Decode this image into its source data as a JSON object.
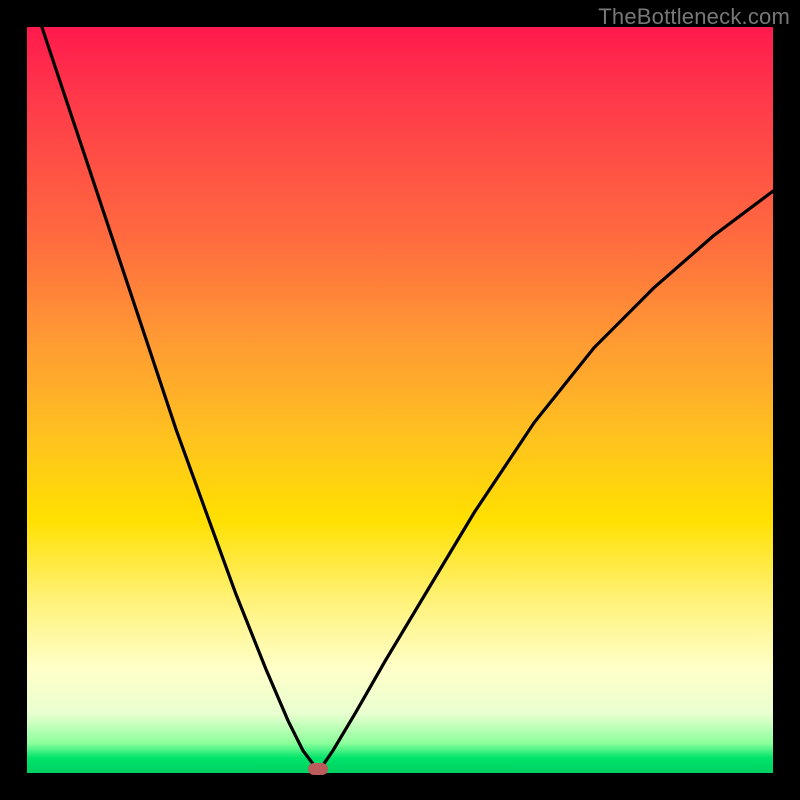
{
  "watermark": "TheBottleneck.com",
  "colors": {
    "frame": "#000000",
    "curve": "#000000",
    "marker": "#bb5b5b",
    "gradient_stops": [
      {
        "pos": 0.0,
        "hex": "#ff1a4d"
      },
      {
        "pos": 0.1,
        "hex": "#ff3a4a"
      },
      {
        "pos": 0.28,
        "hex": "#ff6a3f"
      },
      {
        "pos": 0.42,
        "hex": "#ff9a33"
      },
      {
        "pos": 0.55,
        "hex": "#ffc21f"
      },
      {
        "pos": 0.66,
        "hex": "#ffe000"
      },
      {
        "pos": 0.77,
        "hex": "#fff27a"
      },
      {
        "pos": 0.86,
        "hex": "#ffffc8"
      },
      {
        "pos": 0.92,
        "hex": "#e9ffd0"
      },
      {
        "pos": 0.96,
        "hex": "#8cff9c"
      },
      {
        "pos": 0.98,
        "hex": "#00e46a"
      },
      {
        "pos": 1.0,
        "hex": "#00d060"
      }
    ]
  },
  "chart_data": {
    "type": "line",
    "title": "",
    "xlabel": "",
    "ylabel": "",
    "xlim": [
      0,
      100
    ],
    "ylim": [
      0,
      100
    ],
    "note": "V-shaped bottleneck curve. x is normalized horizontal position (0–100 left→right inside plot). y is normalized vertical position (0 at bottom / green, 100 at top / red). Minimum (optimal point) at x≈39, y≈0.6.",
    "minimum": {
      "x": 39,
      "y": 0.6
    },
    "series": [
      {
        "name": "bottleneck-curve",
        "x": [
          0,
          4,
          8,
          12,
          16,
          20,
          24,
          28,
          32,
          35,
          37,
          38.5,
          39,
          39.5,
          41,
          44,
          48,
          54,
          60,
          68,
          76,
          84,
          92,
          100
        ],
        "y": [
          106,
          94,
          82,
          70,
          58,
          46,
          35,
          24,
          14,
          7,
          3,
          1.0,
          0.6,
          0.8,
          3,
          8,
          15,
          25,
          35,
          47,
          57,
          65,
          72,
          78
        ]
      }
    ],
    "marker": {
      "x": 39,
      "y": 0.6,
      "shape": "rounded-rect"
    }
  }
}
